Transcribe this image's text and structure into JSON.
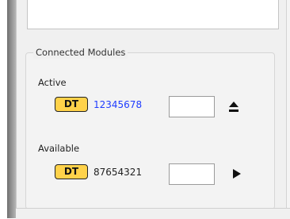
{
  "panel": {
    "group_title": "Connected Modules"
  },
  "modules": {
    "active": {
      "label": "Active",
      "badge": "DT",
      "serial": "12345678",
      "field_value": "",
      "serial_color": "#1f3cff"
    },
    "available": {
      "label": "Available",
      "badge": "DT",
      "serial": "87654321",
      "field_value": "",
      "serial_color": "#222222"
    }
  },
  "icons": {
    "active_action": "eject-icon",
    "available_action": "play-icon"
  },
  "colors": {
    "badge_fill": "#ffd24a",
    "badge_border": "#222222",
    "panel_bg": "#f0f0f0"
  }
}
